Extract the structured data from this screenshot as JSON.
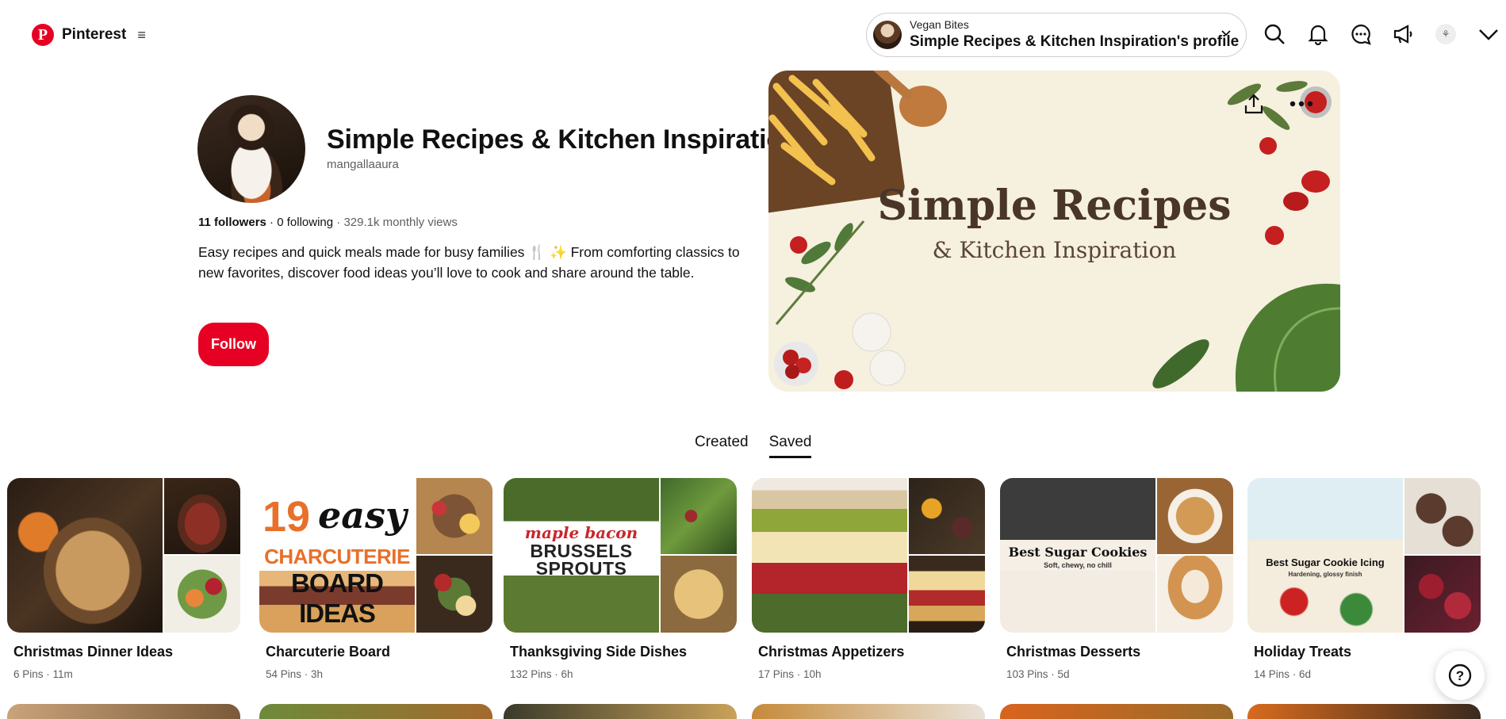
{
  "header": {
    "brand": "Pinterest",
    "brand_logo": "P",
    "menu_icon": "≡",
    "switcher": {
      "label_small": "Vegan Bites",
      "label_main": "Simple Recipes & Kitchen Inspiration's profile"
    },
    "icons": [
      "search-icon",
      "bell-icon",
      "messages-icon",
      "megaphone-icon",
      "account-avatar",
      "chevron-down-icon"
    ]
  },
  "profile": {
    "title": "Simple Recipes & Kitchen Inspiration",
    "handle": "mangallaaura",
    "followers": "11 followers",
    "following": "0 following",
    "views": "329.1k monthly views",
    "separator": " · ",
    "bio": "Easy recipes and quick meals made for busy families 🍴 ✨ From comforting classics to new favorites, discover food ideas you’ll love to cook and share around the table.",
    "follow_label": "Follow"
  },
  "cover": {
    "title": "Simple Recipes",
    "subtitle": "& Kitchen Inspiration"
  },
  "tabs": [
    {
      "label": "Created",
      "active": false
    },
    {
      "label": "Saved",
      "active": true
    }
  ],
  "boards": [
    {
      "name": "Christmas Dinner Ideas",
      "meta": "6 Pins · 11m"
    },
    {
      "name": "Charcuterie Board",
      "meta": "54 Pins · 3h",
      "overlay_big": "19",
      "overlay_script": "easy",
      "overlay_line1": "CHARCUTERIE",
      "overlay_line2": "BOARD IDEAS"
    },
    {
      "name": "Thanksgiving Side Dishes",
      "meta": "132 Pins · 6h",
      "overlay_script": "maple bacon",
      "overlay_line1": "BRUSSELS",
      "overlay_line2": "SPROUTS"
    },
    {
      "name": "Christmas Appetizers",
      "meta": "17 Pins · 10h"
    },
    {
      "name": "Christmas Desserts",
      "meta": "103 Pins · 5d",
      "overlay_line1": "Best Sugar Cookies",
      "overlay_line2": "Soft, chewy, no chill"
    },
    {
      "name": "Holiday Treats",
      "meta": "14 Pins · 6d",
      "overlay_line1": "Best Sugar Cookie Icing",
      "overlay_line2": "Hardening, glossy finish"
    }
  ],
  "help": {
    "label": "?"
  },
  "colors": {
    "accent": "#e60023"
  }
}
